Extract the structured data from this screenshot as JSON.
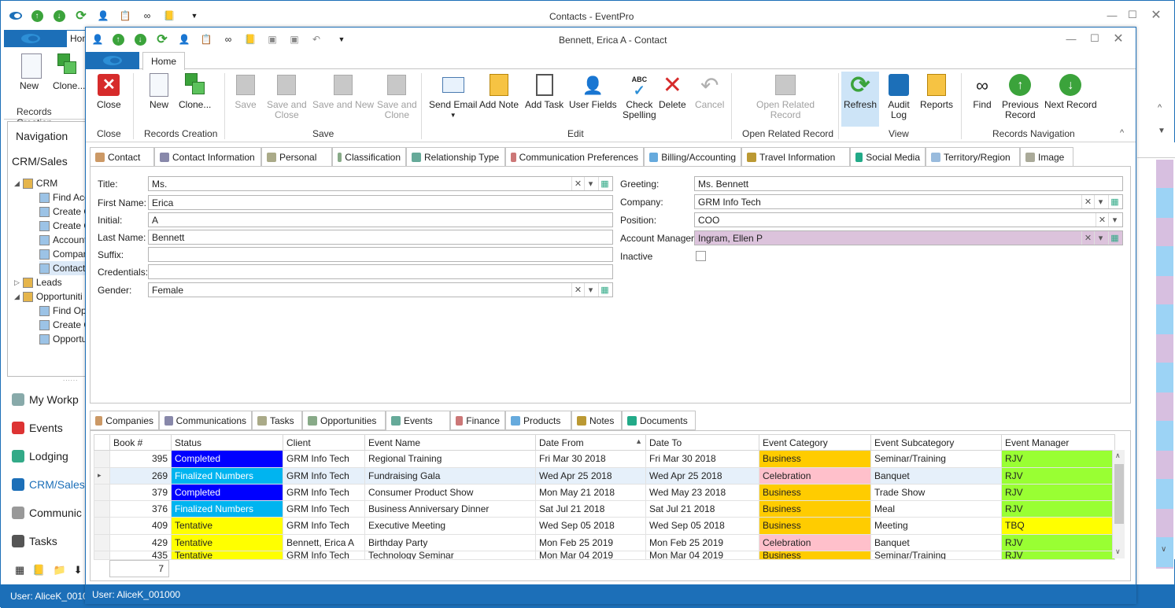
{
  "outer": {
    "title": "Contacts - EventPro",
    "home_tab": "Home",
    "new_label": "New",
    "clone_label": "Clone...",
    "group_label": "Records Creation",
    "status_user": "User: AliceK_001000"
  },
  "navigation": {
    "header": "Navigation",
    "section": "CRM/Sales",
    "tree": [
      {
        "label": "CRM",
        "level": 0
      },
      {
        "label": "Find Acc",
        "level": 1
      },
      {
        "label": "Create C",
        "level": 1
      },
      {
        "label": "Create C",
        "level": 1
      },
      {
        "label": "Account",
        "level": 1
      },
      {
        "label": "Compan",
        "level": 1
      },
      {
        "label": "Contact",
        "level": 1
      },
      {
        "label": "Leads",
        "level": 0
      },
      {
        "label": "Opportuniti",
        "level": 0
      },
      {
        "label": "Find Opp",
        "level": 1
      },
      {
        "label": "Create C",
        "level": 1
      },
      {
        "label": "Opportu",
        "level": 1
      }
    ],
    "modules": [
      "My Workp",
      "Events",
      "Lodging",
      "CRM/Sales",
      "Communic",
      "Tasks"
    ]
  },
  "inner": {
    "title": "Bennett, Erica A - Contact",
    "home_tab": "Home",
    "status_user": "User: AliceK_001000"
  },
  "ribbon": {
    "buttons": {
      "close": "Close",
      "new": "New",
      "clone": "Clone...",
      "save": "Save",
      "save_close_1": "Save and",
      "save_close_2": "Close",
      "save_new": "Save and New",
      "save_clone_1": "Save and",
      "save_clone_2": "Clone",
      "send_email": "Send Email",
      "add_note": "Add Note",
      "add_task": "Add Task",
      "user_fields": "User Fields",
      "check_1": "Check",
      "check_2": "Spelling",
      "delete": "Delete",
      "cancel": "Cancel",
      "open_related_1": "Open Related",
      "open_related_2": "Record",
      "refresh": "Refresh",
      "audit_1": "Audit",
      "audit_2": "Log",
      "reports": "Reports",
      "find": "Find",
      "prev_1": "Previous",
      "prev_2": "Record",
      "next": "Next Record"
    },
    "groups": {
      "close": "Close",
      "records_creation": "Records Creation",
      "save": "Save",
      "edit": "Edit",
      "open_related": "Open Related Record",
      "view": "View",
      "records_navigation": "Records Navigation"
    }
  },
  "detail_tabs": [
    "Contact",
    "Contact Information",
    "Personal",
    "Classification",
    "Relationship Type",
    "Communication Preferences",
    "Billing/Accounting",
    "Travel Information",
    "Social Media",
    "Territory/Region",
    "Image"
  ],
  "form": {
    "left": [
      {
        "label": "Title:",
        "value": "Ms."
      },
      {
        "label": "First Name:",
        "value": "Erica"
      },
      {
        "label": "Initial:",
        "value": "A"
      },
      {
        "label": "Last Name:",
        "value": "Bennett"
      },
      {
        "label": "Suffix:",
        "value": ""
      },
      {
        "label": "Credentials:",
        "value": ""
      },
      {
        "label": "Gender:",
        "value": "Female"
      }
    ],
    "right": [
      {
        "label": "Greeting:",
        "value": "Ms. Bennett"
      },
      {
        "label": "Company:",
        "value": "GRM Info Tech"
      },
      {
        "label": "Position:",
        "value": "COO"
      },
      {
        "label": "Account Manager:",
        "value": "Ingram, Ellen P"
      },
      {
        "label": "Inactive",
        "value": ""
      }
    ],
    "account_manager_color": "#dcc3dc"
  },
  "bottom_tabs": [
    "Companies",
    "Communications",
    "Tasks",
    "Opportunities",
    "Events",
    "Finance",
    "Products",
    "Notes",
    "Documents"
  ],
  "grid": {
    "columns": [
      "Book #",
      "Status",
      "Client",
      "Event Name",
      "Date From",
      "Date To",
      "Event Category",
      "Event Subcategory",
      "Event Manager"
    ],
    "rows": [
      {
        "book": "395",
        "status": "Completed",
        "client": "GRM Info Tech",
        "name": "Regional Training",
        "from": "Fri Mar 30 2018",
        "to": "Fri Mar 30 2018",
        "cat": "Business",
        "sub": "Seminar/Training",
        "mgr": "RJV"
      },
      {
        "book": "269",
        "status": "Finalized Numbers",
        "client": "GRM Info Tech",
        "name": "Fundraising Gala",
        "from": "Wed Apr 25 2018",
        "to": "Wed Apr 25 2018",
        "cat": "Celebration",
        "sub": "Banquet",
        "mgr": "RJV"
      },
      {
        "book": "379",
        "status": "Completed",
        "client": "GRM Info Tech",
        "name": "Consumer Product Show",
        "from": "Mon May 21 2018",
        "to": "Wed May 23 2018",
        "cat": "Business",
        "sub": "Trade Show",
        "mgr": "RJV"
      },
      {
        "book": "376",
        "status": "Finalized Numbers",
        "client": "GRM Info Tech",
        "name": "Business Anniversary Dinner",
        "from": "Sat Jul 21 2018",
        "to": "Sat Jul 21 2018",
        "cat": "Business",
        "sub": "Meal",
        "mgr": "RJV"
      },
      {
        "book": "409",
        "status": "Tentative",
        "client": "GRM Info Tech",
        "name": "Executive Meeting",
        "from": "Wed Sep 05 2018",
        "to": "Wed Sep 05 2018",
        "cat": "Business",
        "sub": "Meeting",
        "mgr": "TBQ"
      },
      {
        "book": "429",
        "status": "Tentative",
        "client": "Bennett, Erica A",
        "name": "Birthday Party",
        "from": "Mon Feb 25 2019",
        "to": "Mon Feb 25 2019",
        "cat": "Celebration",
        "sub": "Banquet",
        "mgr": "RJV"
      },
      {
        "book": "435",
        "status": "Tentative",
        "client": "GRM Info Tech",
        "name": "Technology Seminar",
        "from": "Mon Mar 04 2019",
        "to": "Mon Mar 04 2019",
        "cat": "Business",
        "sub": "Seminar/Training",
        "mgr": "RJV"
      }
    ],
    "record_count": "7",
    "status_colors": {
      "Completed": "#0000ff",
      "Finalized Numbers": "#00b4f0",
      "Tentative": "#ffff00"
    },
    "category_colors": {
      "Business": "#ffcc00",
      "Celebration": "#ffc0cb"
    },
    "manager_colors": {
      "RJV": "#99ff33",
      "TBQ": "#ffff00"
    }
  }
}
